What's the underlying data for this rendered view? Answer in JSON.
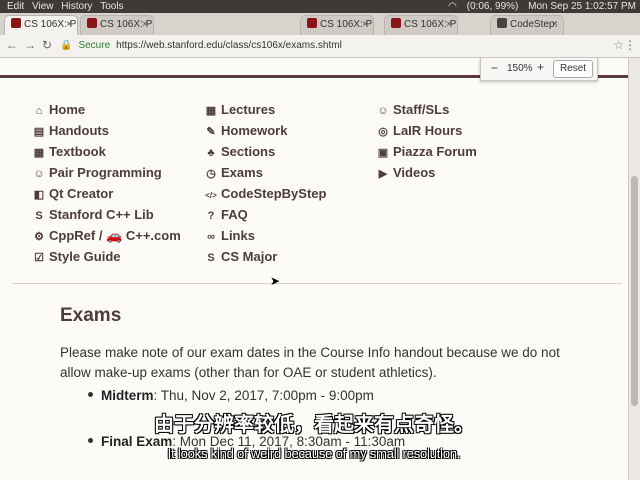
{
  "os_menu": {
    "items": [
      "Edit",
      "View",
      "History",
      "Tools"
    ],
    "status": {
      "battery": "(0:06, 99%)",
      "time": "Mon Sep 25  1:02:57 PM"
    }
  },
  "browser": {
    "tabs": [
      {
        "label": "CS 106X: P"
      },
      {
        "label": "CS 106X: P"
      },
      {
        "label": "CS 106X: P"
      },
      {
        "label": "CS 106X: P"
      },
      {
        "label": "CodeStep:"
      }
    ],
    "secure_label": "Secure",
    "url": "https://web.stanford.edu/class/cs106x/exams.shtml",
    "zoom": {
      "minus": "−",
      "level": "150%",
      "plus": "+",
      "reset": "Reset"
    }
  },
  "nav": {
    "col1": [
      {
        "icon": "home-icon",
        "glyph": "⌂",
        "label": "Home"
      },
      {
        "icon": "handouts-icon",
        "glyph": "▤",
        "label": "Handouts"
      },
      {
        "icon": "book-icon",
        "glyph": "▦",
        "label": "Textbook"
      },
      {
        "icon": "users-icon",
        "glyph": "☺",
        "label": "Pair Programming"
      },
      {
        "icon": "qt-icon",
        "glyph": "◧",
        "label": "Qt Creator"
      },
      {
        "icon": "stanford-icon",
        "glyph": "S",
        "label": "Stanford C++ Lib"
      },
      {
        "icon": "car-icon",
        "glyph": "⚙",
        "label": "CppRef / 🚗 C++.com"
      },
      {
        "icon": "checkbox-icon",
        "glyph": "☑",
        "label": "Style Guide"
      }
    ],
    "col2": [
      {
        "icon": "calendar-icon",
        "glyph": "▦",
        "label": "Lectures"
      },
      {
        "icon": "edit-icon",
        "glyph": "✎",
        "label": "Homework"
      },
      {
        "icon": "tree-icon",
        "glyph": "♣",
        "label": "Sections"
      },
      {
        "icon": "clock-icon",
        "glyph": "◷",
        "label": "Exams"
      },
      {
        "icon": "code-icon",
        "glyph": "</>",
        "label": "CodeStepByStep"
      },
      {
        "icon": "question-icon",
        "glyph": "?",
        "label": "FAQ"
      },
      {
        "icon": "link-icon",
        "glyph": "∞",
        "label": "Links"
      },
      {
        "icon": "major-icon",
        "glyph": "S",
        "label": "CS Major"
      }
    ],
    "col3": [
      {
        "icon": "smile-icon",
        "glyph": "☺",
        "label": "Staff/SLs"
      },
      {
        "icon": "lifebuoy-icon",
        "glyph": "◎",
        "label": "LaIR Hours"
      },
      {
        "icon": "piazza-icon",
        "glyph": "▣",
        "label": "Piazza Forum"
      },
      {
        "icon": "play-icon",
        "glyph": "▶",
        "label": "Videos"
      }
    ]
  },
  "content": {
    "title": "Exams",
    "intro": "Please make note of our exam dates in the Course Info handout because we do not allow make-up exams (other than for OAE or student athletics).",
    "exams": [
      {
        "name": "Midterm",
        "when": "Thu, Nov 2, 2017, 7:00pm - 9:00pm"
      },
      {
        "name": "Final Exam",
        "when": "Mon Dec 11, 2017, 8:30am - 11:30am"
      }
    ]
  },
  "subtitles": {
    "zh": "由于分辨率较低，看起来有点奇怪。",
    "en": "It looks kind of weird because of my small resolution."
  }
}
